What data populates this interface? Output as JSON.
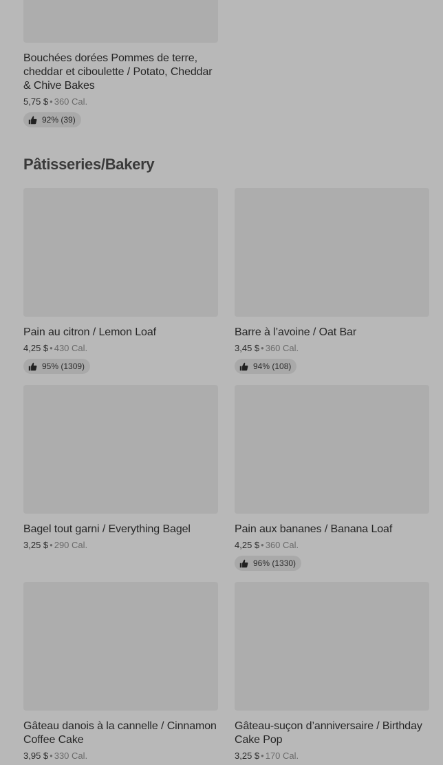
{
  "items_top": [
    {
      "name": "Bouchées dorées Pommes de terre, cheddar et ciboulette / Potato, Cheddar & Chive Bakes",
      "price": "5,75 $",
      "calories": "360 Cal.",
      "rating": "92% (39)"
    }
  ],
  "bakery": {
    "title": "Pâtisseries/Bakery",
    "items": [
      {
        "name": "Pain au citron / Lemon Loaf",
        "price": "4,25 $",
        "calories": "430 Cal.",
        "rating": "95% (1309)"
      },
      {
        "name": "Barre à l’avoine / Oat Bar",
        "price": "3,45 $",
        "calories": "360 Cal.",
        "rating": "94% (108)"
      },
      {
        "name": "Bagel tout garni / Everything Bagel",
        "price": "3,25 $",
        "calories": "290 Cal.",
        "rating": ""
      },
      {
        "name": "Pain aux bananes / Banana Loaf",
        "price": "4,25 $",
        "calories": "360 Cal.",
        "rating": "96% (1330)"
      },
      {
        "name": "Gâteau danois à la cannelle / Cinnamon Coffee Cake",
        "price": "3,95 $",
        "calories": "330 Cal.",
        "rating": ""
      },
      {
        "name": "Gâteau-suçon d’anniversaire / Birthday Cake Pop",
        "price": "3,25 $",
        "calories": "170 Cal.",
        "rating": ""
      }
    ]
  },
  "separator": "•",
  "icons": {
    "rating": "thumbs-up-icon"
  }
}
